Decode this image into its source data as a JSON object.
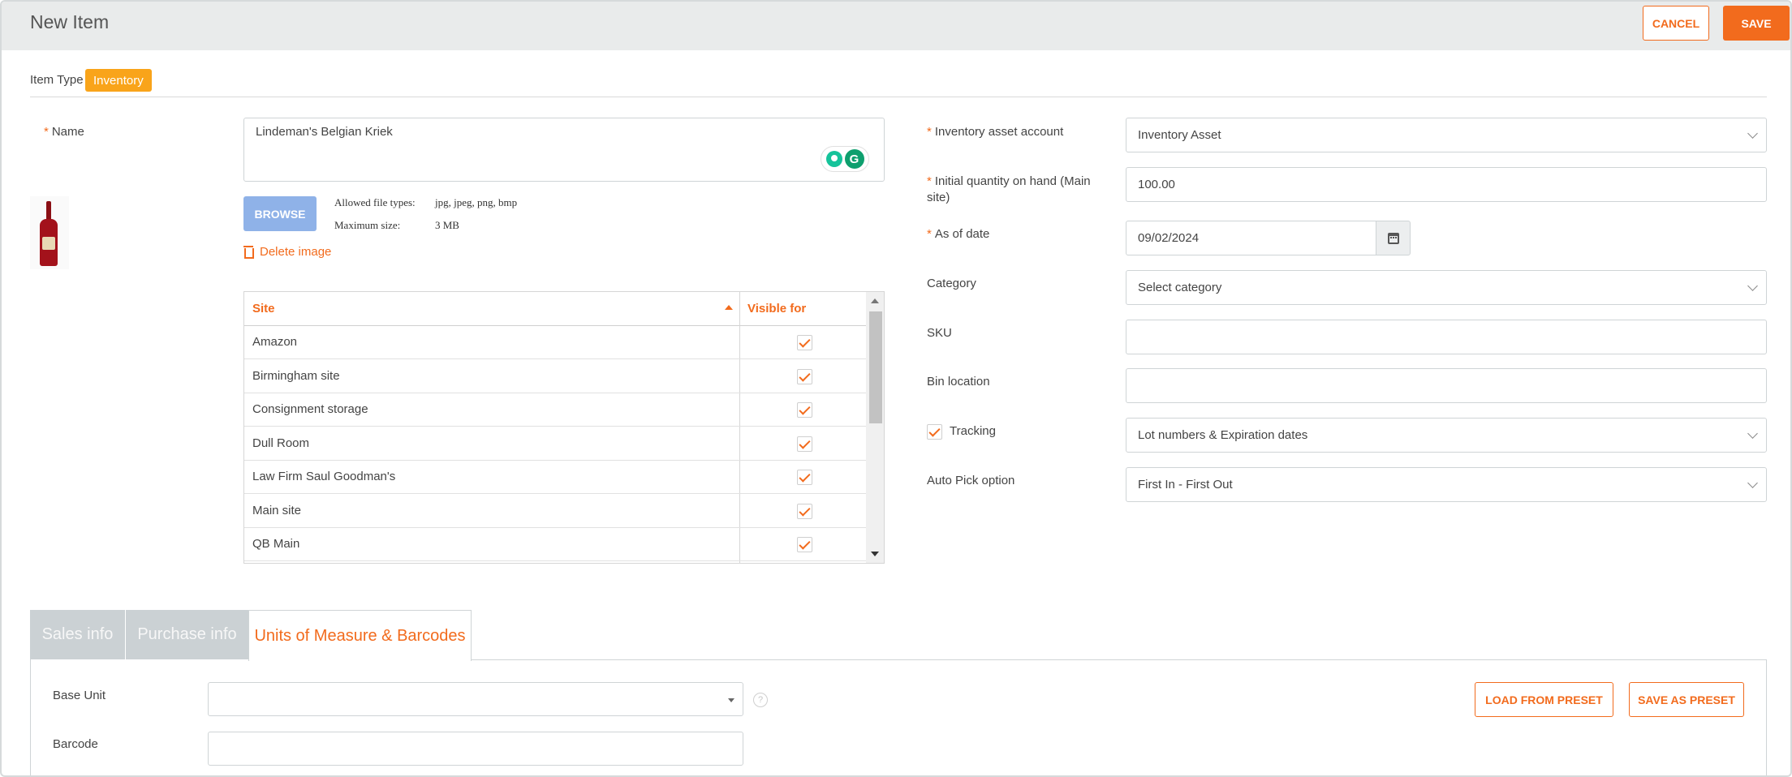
{
  "header": {
    "title": "New Item",
    "cancel_label": "CANCEL",
    "save_label": "SAVE"
  },
  "item_type": {
    "label": "Item Type",
    "value": "Inventory"
  },
  "name": {
    "label": "Name",
    "value": "Lindeman's Belgian Kriek"
  },
  "image": {
    "browse_label": "BROWSE",
    "allowed_types_label": "Allowed file types:",
    "allowed_types_value": "jpg, jpeg, png, bmp",
    "max_size_label": "Maximum size:",
    "max_size_value": "3 MB",
    "delete_label": "Delete image"
  },
  "sites_grid": {
    "headers": {
      "site": "Site",
      "visible_for": "Visible for"
    },
    "rows": [
      {
        "site": "Amazon",
        "visible": true
      },
      {
        "site": "Birmingham site",
        "visible": true
      },
      {
        "site": "Consignment storage",
        "visible": true
      },
      {
        "site": "Dull Room",
        "visible": true
      },
      {
        "site": "Law Firm Saul Goodman's",
        "visible": true
      },
      {
        "site": "Main site",
        "visible": true
      },
      {
        "site": "QB Main",
        "visible": true
      }
    ]
  },
  "right_form": {
    "asset_account": {
      "label": "Inventory asset account",
      "value": "Inventory Asset"
    },
    "initial_qty": {
      "label": "Initial quantity on hand (Main site)",
      "value": "100.00"
    },
    "as_of_date": {
      "label": "As of date",
      "value": "09/02/2024"
    },
    "category": {
      "label": "Category",
      "value": "Select category"
    },
    "sku": {
      "label": "SKU",
      "value": ""
    },
    "bin_location": {
      "label": "Bin location",
      "value": ""
    },
    "tracking": {
      "label": "Tracking",
      "checked": true,
      "value": "Lot numbers & Expiration dates"
    },
    "auto_pick": {
      "label": "Auto Pick option",
      "value": "First In - First Out"
    }
  },
  "tabs": [
    {
      "label": "Sales info",
      "active": false
    },
    {
      "label": "Purchase info",
      "active": false
    },
    {
      "label": "Units of Measure & Barcodes",
      "active": true
    }
  ],
  "uom": {
    "base_unit_label": "Base Unit",
    "base_unit_value": "",
    "help_icon_glyph": "?",
    "barcode_label": "Barcode",
    "barcode_value": "",
    "load_preset_label": "LOAD FROM PRESET",
    "save_preset_label": "SAVE AS PRESET"
  },
  "colors": {
    "accent": "#f26b1d",
    "badge": "#f9a41a",
    "browse": "#8fb2e8"
  }
}
